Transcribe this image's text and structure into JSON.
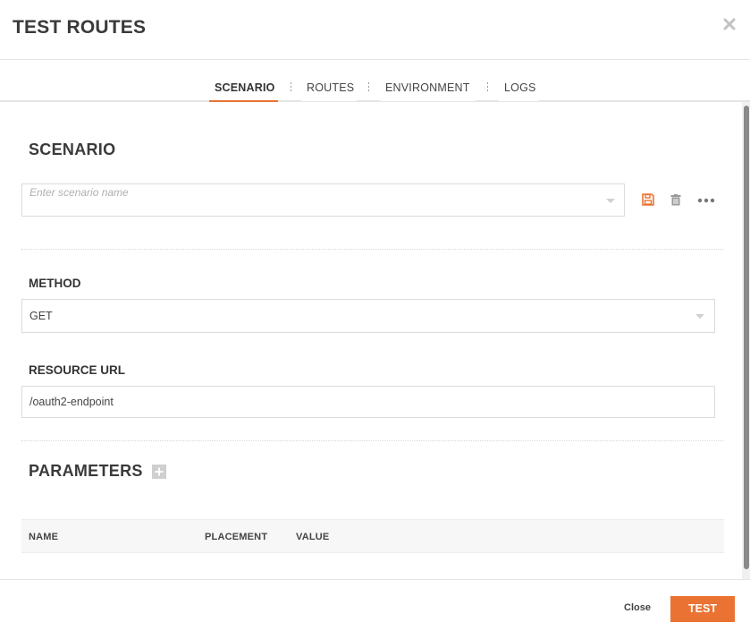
{
  "header": {
    "title": "TEST ROUTES"
  },
  "tabs": [
    {
      "label": "SCENARIO",
      "active": true
    },
    {
      "label": "ROUTES",
      "active": false
    },
    {
      "label": "ENVIRONMENT",
      "active": false
    },
    {
      "label": "LOGS",
      "active": false
    }
  ],
  "scenario": {
    "section_title": "SCENARIO",
    "name_placeholder": "Enter scenario name",
    "actions": [
      "save-icon",
      "trash-icon",
      "more-icon"
    ]
  },
  "method": {
    "label": "METHOD",
    "value": "GET"
  },
  "resource_url": {
    "label": "RESOURCE URL",
    "value": "/oauth2-endpoint"
  },
  "parameters": {
    "section_title": "PARAMETERS",
    "columns": [
      "NAME",
      "PLACEMENT",
      "VALUE"
    ]
  },
  "footer": {
    "close_label": "Close",
    "test_label": "TEST"
  },
  "colors": {
    "accent": "#ea7232",
    "border": "#dcdcdc",
    "text": "#333333"
  }
}
